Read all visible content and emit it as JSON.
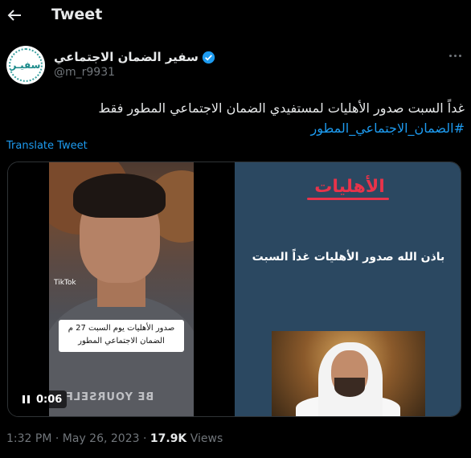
{
  "header": {
    "title": "Tweet"
  },
  "author": {
    "name": "سفير الضمان الاجتماعي",
    "handle": "@m_r9931",
    "avatar_text": "سفيـر"
  },
  "tweet": {
    "line1": "غداً السبت صدور الأهليات لمستفيدي الضمان الاجتماعي المطور فقط",
    "hashtag": "#الضمان_الاجتماعي_المطور",
    "translate_label": "Translate Tweet"
  },
  "media": {
    "caption_line1": "صدور الأهليات يوم السبت 27 م",
    "caption_line2": "الضمان الاجتماعي المطور",
    "shirt_text": "BE YOURSELF",
    "tiktok_label": "TikTok",
    "slide_title": "الأهليات",
    "slide_body": "باذن الله صدور الأهليات غداً السبت",
    "video_time": "0:06"
  },
  "meta": {
    "time": "1:32 PM",
    "separator": " · ",
    "date": "May 26, 2023",
    "views_count": "17.9K",
    "views_label": " Views"
  },
  "colors": {
    "accent": "#1d9bf0",
    "background": "#000000",
    "slide_bg": "#2b4861",
    "slide_title": "#e8334a"
  }
}
